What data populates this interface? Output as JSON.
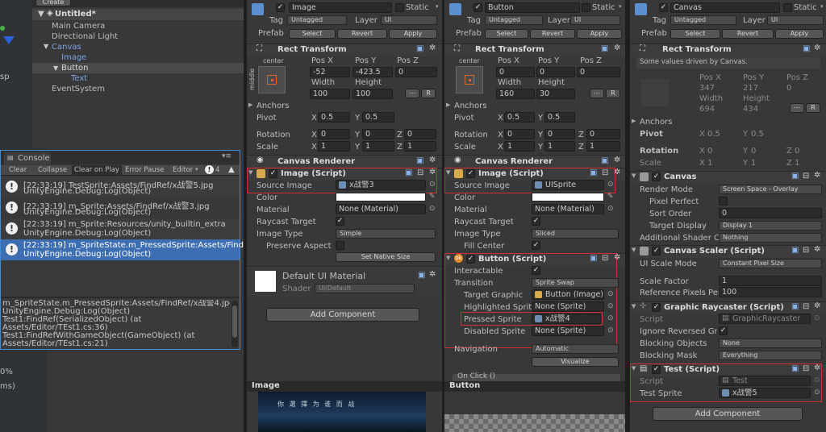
{
  "hierarchy": {
    "create_label": "Create",
    "scene_title": "Untitled*",
    "items": [
      "Main Camera",
      "Directional Light",
      "Canvas",
      "Image",
      "Button",
      "Text",
      "EventSystem"
    ]
  },
  "scene_view": {
    "side_label": "sp",
    "pct": "0%",
    "ms": "ms)"
  },
  "console": {
    "title": "Console",
    "toolbar": [
      "Clear",
      "Collapse",
      "Clear on Play",
      "Error Pause",
      "Editor"
    ],
    "count": "4",
    "entries": [
      {
        "line1": "[22:33:19] TestSprite:Assets/FindRef/x战警5.jpg",
        "line2": "UnityEngine.Debug:Log(Object)"
      },
      {
        "line1": "[22:33:19] m_Sprite:Assets/FindRef/x战警3.jpg",
        "line2": "UnityEngine.Debug:Log(Object)"
      },
      {
        "line1": "[22:33:19] m_Sprite:Resources/unity_builtin_extra",
        "line2": "UnityEngine.Debug:Log(Object)"
      },
      {
        "line1": "[22:33:19] m_SpriteState.m_PressedSprite:Assets/FindF",
        "line2": "UnityEngine.Debug:Log(Object)"
      }
    ],
    "detail": [
      "m_SpriteState.m_PressedSprite:Assets/FindRef/x战警4.jpg",
      "UnityEngine.Debug:Log(Object)",
      "Test1:FindRef(SerializedObject) (at",
      "Assets/Editor/TEst1.cs:36)",
      "Test1:FindRefWithGameObject(GameObject) (at",
      "Assets/Editor/TEst1.cs:21)"
    ]
  },
  "common": {
    "static": "Static",
    "tag": "Tag",
    "untagged": "Untagged",
    "layer": "Layer",
    "ui": "UI",
    "prefab": "Prefab",
    "select": "Select",
    "revert": "Revert",
    "apply": "Apply",
    "rect_transform": "Rect Transform",
    "center": "center",
    "middle": "middle",
    "pos_x": "Pos X",
    "pos_y": "Pos Y",
    "pos_z": "Pos Z",
    "width": "Width",
    "height": "Height",
    "anchors": "Anchors",
    "pivot": "Pivot",
    "rotation": "Rotation",
    "scale": "Scale",
    "x": "X",
    "y": "Y",
    "z": "Z",
    "r": "R",
    "canvas_renderer": "Canvas Renderer",
    "add_component": "Add Component"
  },
  "image_insp": {
    "name": "Image",
    "pos": [
      "-52",
      "-423.5",
      "0"
    ],
    "size": [
      "100",
      "100"
    ],
    "pivot": [
      "0.5",
      "0.5"
    ],
    "rot": [
      "0",
      "0",
      "0"
    ],
    "scl": [
      "1",
      "1",
      "1"
    ],
    "script_title": "Image (Script)",
    "rows": {
      "source_image": "Source Image",
      "color": "Color",
      "material": "Material",
      "raycast": "Raycast Target",
      "image_type": "Image Type",
      "preserve": "Preserve Aspect"
    },
    "source_val": "x战警3",
    "material_val": "None (Material)",
    "type_val": "Simple",
    "set_native": "Set Native Size",
    "mat_name": "Default UI Material",
    "shader": "Shader",
    "shader_val": "UI/Default",
    "footer": "Image"
  },
  "button_insp": {
    "name": "Button",
    "pos": [
      "0",
      "0",
      "0"
    ],
    "size": [
      "160",
      "30"
    ],
    "pivot": [
      "0.5",
      "0.5"
    ],
    "rot": [
      "0",
      "0",
      "0"
    ],
    "scl": [
      "1",
      "1",
      "1"
    ],
    "img_title": "Image (Script)",
    "source_val": "UISprite",
    "material_val": "None (Material)",
    "type_val": "Sliced",
    "fill_center": "Fill Center",
    "btn_title": "Button (Script)",
    "rows": {
      "interactable": "Interactable",
      "transition": "Transition",
      "target": "Target Graphic",
      "highlighted": "Highlighted Sprite",
      "pressed": "Pressed Sprite",
      "disabled": "Disabled Sprite",
      "navigation": "Navigation"
    },
    "transition_val": "Sprite Swap",
    "target_val": "Button (Image)",
    "highlighted_val": "None (Sprite)",
    "pressed_val": "x战警4",
    "disabled_val": "None (Sprite)",
    "navigation_val": "Automatic",
    "visualize": "Visualize",
    "onclick": "On Click ()",
    "footer": "Button"
  },
  "canvas_insp": {
    "name": "Canvas",
    "driven": "Some values driven by Canvas.",
    "pos": [
      "347",
      "217",
      "0"
    ],
    "size": [
      "694",
      "434"
    ],
    "pivot": [
      "0.5",
      "0.5"
    ],
    "rot": [
      "0",
      "0",
      "0"
    ],
    "scl": [
      "1",
      "1",
      "1"
    ],
    "canvas_title": "Canvas",
    "render_mode": "Render Mode",
    "render_val": "Screen Space - Overlay",
    "pixel_perfect": "Pixel Perfect",
    "sort_order": "Sort Order",
    "sort_val": "0",
    "target_display": "Target Display",
    "display_val": "Display 1",
    "add_shader": "Additional Shader Cl",
    "shader_val": "Nothing",
    "scaler_title": "Canvas Scaler (Script)",
    "scale_mode": "UI Scale Mode",
    "scale_mode_val": "Constant Pixel Size",
    "scale_factor": "Scale Factor",
    "scale_factor_val": "1",
    "ref_ppu": "Reference Pixels Per",
    "ref_ppu_val": "100",
    "raycaster_title": "Graphic Raycaster (Script)",
    "script": "Script",
    "script_val": "GraphicRaycaster",
    "ignore_rev": "Ignore Reversed Gra",
    "blocking_obj": "Blocking Objects",
    "blocking_obj_val": "None",
    "blocking_mask": "Blocking Mask",
    "blocking_mask_val": "Everything",
    "test_title": "Test (Script)",
    "test_script_val": "Test",
    "test_sprite": "Test Sprite",
    "test_sprite_val": "x战警5",
    "preview_text": "你 選 擇 为 谁 而 战"
  }
}
